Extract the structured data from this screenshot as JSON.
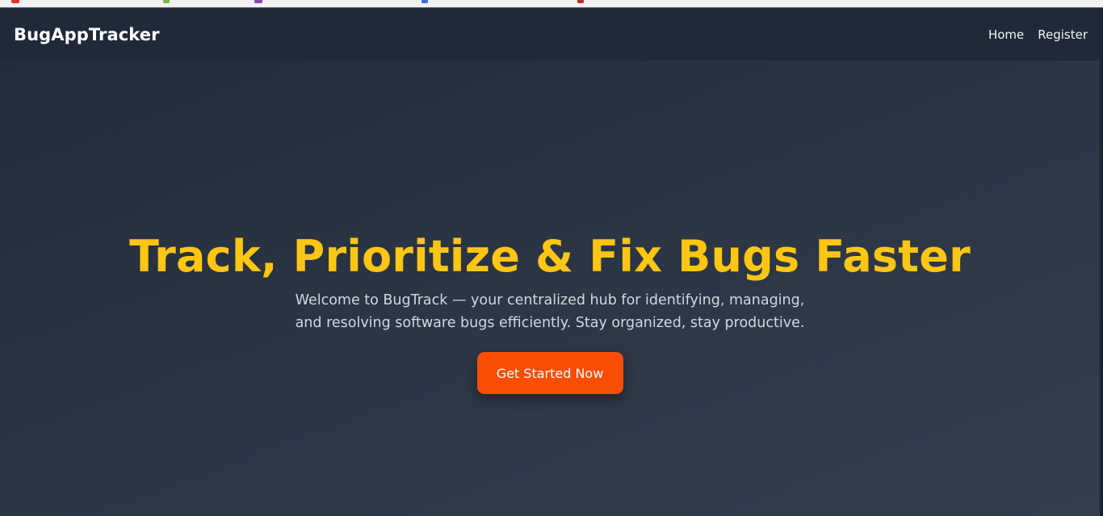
{
  "navbar": {
    "brand": "BugAppTracker",
    "links": [
      {
        "label": "Home"
      },
      {
        "label": "Register"
      }
    ]
  },
  "hero": {
    "title": "Track, Prioritize & Fix Bugs Faster",
    "description": "Welcome to BugTrack — your centralized hub for identifying, managing, and resolving software bugs efficiently. Stay organized, stay productive.",
    "cta_label": "Get Started Now"
  },
  "colors": {
    "navbar_bg": "#1f2938",
    "page_bg": "#2a3443",
    "title": "#fdc614",
    "cta_bg": "#f94d06"
  }
}
